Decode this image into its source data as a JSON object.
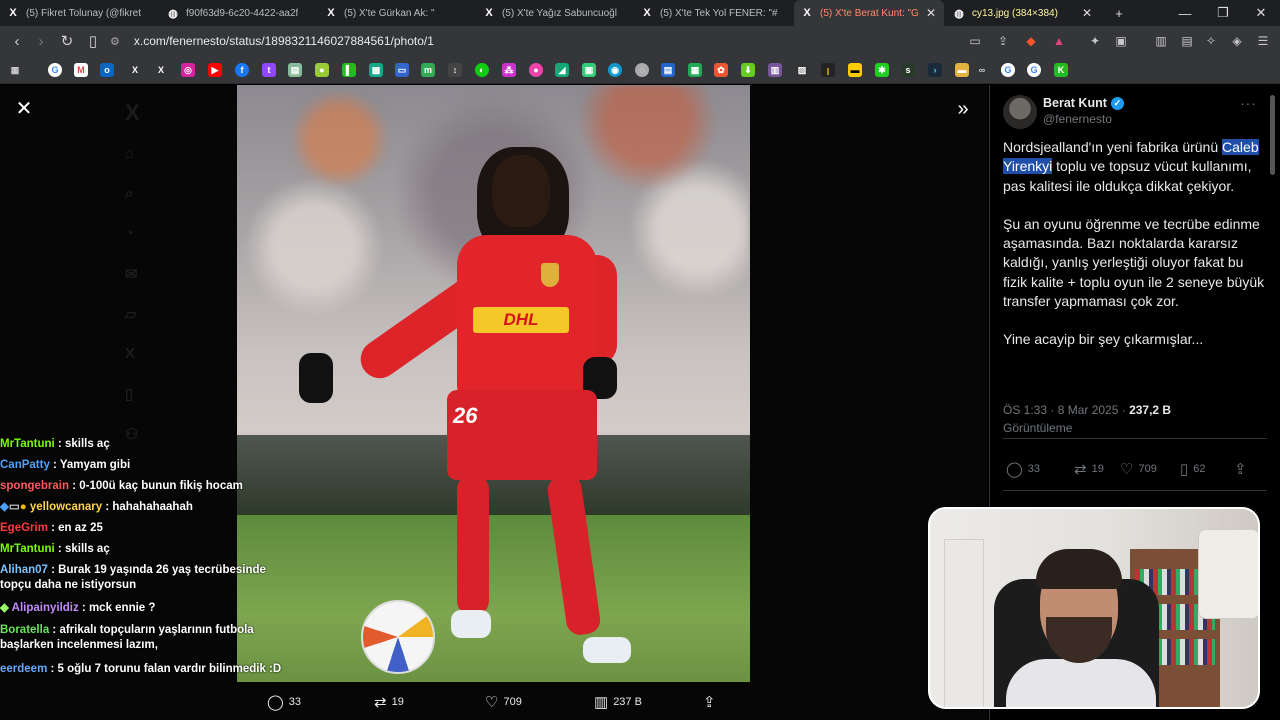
{
  "browser": {
    "tabs": [
      {
        "title": "(5) Fikret Tolunay (@fikret",
        "icon": "X"
      },
      {
        "title": "f90f63d9-6c20-4422-aa2f",
        "icon": "globe"
      },
      {
        "title": "(5) X'te Gürkan Ak: \"",
        "icon": "X"
      },
      {
        "title": "(5) X'te Yağız Sabuncuoğl",
        "icon": "X"
      },
      {
        "title": "(5) X'te Tek Yol FENER: \"#",
        "icon": "X"
      },
      {
        "title": "(5) X'te Berat Kunt: \"G",
        "icon": "X",
        "active": true
      },
      {
        "title": "cy13.jpg (384×384)",
        "icon": "globe"
      }
    ],
    "url": "x.com/fenernesto/status/1898321146027884561/photo/1"
  },
  "viewer": {
    "chat": [
      {
        "user": "MrTantuni",
        "color": "#7cfc00",
        "msg": " : skills aç"
      },
      {
        "user": "CanPatty",
        "color": "#4aa3ff",
        "msg": " : Yamyam gibi"
      },
      {
        "user": "spongebrain",
        "color": "#ff5a5a",
        "msg": " : 0-100ü kaç bunun fikiş hocam"
      },
      {
        "user": "yellowcanary",
        "color": "#ffd54a",
        "msg": " : hahahahaahah",
        "badges": true
      },
      {
        "user": "EgeGrim",
        "color": "#ff3b3b",
        "msg": " : en az 25"
      },
      {
        "user": "MrTantuni",
        "color": "#7cfc00",
        "msg": " : skills aç"
      },
      {
        "user": "Alihan07",
        "color": "#7cc4ff",
        "msg": " : Burak 19 yaşında 26 yaş tecrübesinde topçu daha ne istiyorsun"
      },
      {
        "user": "Alipainyildiz",
        "color": "#c38bff",
        "msg": " : mck ennie ?",
        "badge_diamond": true
      },
      {
        "user": "Boratella",
        "color": "#6ee35e",
        "msg": " : afrikalı topçuların yaşlarının futbola başlarken incelenmesi lazım,"
      },
      {
        "user": "eerdeem",
        "color": "#6aa8ff",
        "msg": " : 5 oğlu 7 torunu falan vardır bilinmedik :D"
      }
    ],
    "shirt_number": "26",
    "sponsor": "DHL",
    "actions": {
      "replies": "33",
      "reposts": "19",
      "likes": "709",
      "views": "237 B"
    }
  },
  "tweet": {
    "author_name": "Berat Kunt",
    "author_handle": "@fenernesto",
    "paragraph1_pre": "Nordsjealland'ın yeni fabrika ürünü ",
    "paragraph1_highlight": "Caleb Yirenkyi",
    "paragraph1_post": " toplu ve topsuz vücut kullanımı, pas kalitesi ile oldukça dikkat çekiyor.",
    "paragraph2": "Şu an oyunu öğrenme ve tecrübe edinme aşamasında. Bazı noktalarda kararsız kaldığı, yanlış yerleştiği oluyor fakat bu fizik kalite + toplu oyun ile 2 seneye büyük transfer yapmaması çok zor.",
    "paragraph3": "Yine acayip bir şey çıkarmışlar...",
    "time": "ÖS 1:33 · 8 Mar 2025 · ",
    "views": "237,2 B",
    "views_label": "Görüntüleme",
    "stats": {
      "replies": "33",
      "reposts": "19",
      "likes": "709",
      "bookmarks": "62"
    }
  }
}
